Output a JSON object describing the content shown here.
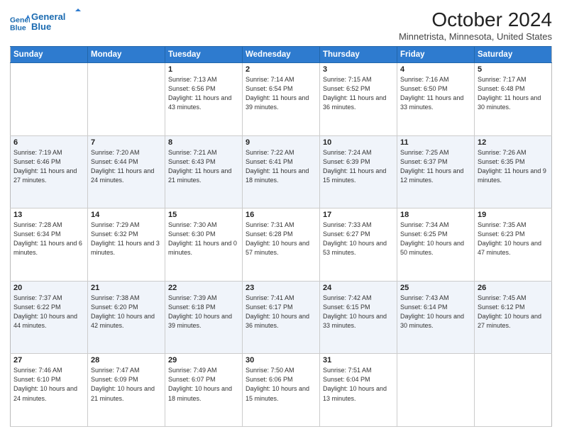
{
  "header": {
    "logo_line1": "General",
    "logo_line2": "Blue",
    "month_title": "October 2024",
    "location": "Minnetrista, Minnesota, United States"
  },
  "days_of_week": [
    "Sunday",
    "Monday",
    "Tuesday",
    "Wednesday",
    "Thursday",
    "Friday",
    "Saturday"
  ],
  "weeks": [
    [
      {
        "day": "",
        "sunrise": "",
        "sunset": "",
        "daylight": ""
      },
      {
        "day": "",
        "sunrise": "",
        "sunset": "",
        "daylight": ""
      },
      {
        "day": "1",
        "sunrise": "Sunrise: 7:13 AM",
        "sunset": "Sunset: 6:56 PM",
        "daylight": "Daylight: 11 hours and 43 minutes."
      },
      {
        "day": "2",
        "sunrise": "Sunrise: 7:14 AM",
        "sunset": "Sunset: 6:54 PM",
        "daylight": "Daylight: 11 hours and 39 minutes."
      },
      {
        "day": "3",
        "sunrise": "Sunrise: 7:15 AM",
        "sunset": "Sunset: 6:52 PM",
        "daylight": "Daylight: 11 hours and 36 minutes."
      },
      {
        "day": "4",
        "sunrise": "Sunrise: 7:16 AM",
        "sunset": "Sunset: 6:50 PM",
        "daylight": "Daylight: 11 hours and 33 minutes."
      },
      {
        "day": "5",
        "sunrise": "Sunrise: 7:17 AM",
        "sunset": "Sunset: 6:48 PM",
        "daylight": "Daylight: 11 hours and 30 minutes."
      }
    ],
    [
      {
        "day": "6",
        "sunrise": "Sunrise: 7:19 AM",
        "sunset": "Sunset: 6:46 PM",
        "daylight": "Daylight: 11 hours and 27 minutes."
      },
      {
        "day": "7",
        "sunrise": "Sunrise: 7:20 AM",
        "sunset": "Sunset: 6:44 PM",
        "daylight": "Daylight: 11 hours and 24 minutes."
      },
      {
        "day": "8",
        "sunrise": "Sunrise: 7:21 AM",
        "sunset": "Sunset: 6:43 PM",
        "daylight": "Daylight: 11 hours and 21 minutes."
      },
      {
        "day": "9",
        "sunrise": "Sunrise: 7:22 AM",
        "sunset": "Sunset: 6:41 PM",
        "daylight": "Daylight: 11 hours and 18 minutes."
      },
      {
        "day": "10",
        "sunrise": "Sunrise: 7:24 AM",
        "sunset": "Sunset: 6:39 PM",
        "daylight": "Daylight: 11 hours and 15 minutes."
      },
      {
        "day": "11",
        "sunrise": "Sunrise: 7:25 AM",
        "sunset": "Sunset: 6:37 PM",
        "daylight": "Daylight: 11 hours and 12 minutes."
      },
      {
        "day": "12",
        "sunrise": "Sunrise: 7:26 AM",
        "sunset": "Sunset: 6:35 PM",
        "daylight": "Daylight: 11 hours and 9 minutes."
      }
    ],
    [
      {
        "day": "13",
        "sunrise": "Sunrise: 7:28 AM",
        "sunset": "Sunset: 6:34 PM",
        "daylight": "Daylight: 11 hours and 6 minutes."
      },
      {
        "day": "14",
        "sunrise": "Sunrise: 7:29 AM",
        "sunset": "Sunset: 6:32 PM",
        "daylight": "Daylight: 11 hours and 3 minutes."
      },
      {
        "day": "15",
        "sunrise": "Sunrise: 7:30 AM",
        "sunset": "Sunset: 6:30 PM",
        "daylight": "Daylight: 11 hours and 0 minutes."
      },
      {
        "day": "16",
        "sunrise": "Sunrise: 7:31 AM",
        "sunset": "Sunset: 6:28 PM",
        "daylight": "Daylight: 10 hours and 57 minutes."
      },
      {
        "day": "17",
        "sunrise": "Sunrise: 7:33 AM",
        "sunset": "Sunset: 6:27 PM",
        "daylight": "Daylight: 10 hours and 53 minutes."
      },
      {
        "day": "18",
        "sunrise": "Sunrise: 7:34 AM",
        "sunset": "Sunset: 6:25 PM",
        "daylight": "Daylight: 10 hours and 50 minutes."
      },
      {
        "day": "19",
        "sunrise": "Sunrise: 7:35 AM",
        "sunset": "Sunset: 6:23 PM",
        "daylight": "Daylight: 10 hours and 47 minutes."
      }
    ],
    [
      {
        "day": "20",
        "sunrise": "Sunrise: 7:37 AM",
        "sunset": "Sunset: 6:22 PM",
        "daylight": "Daylight: 10 hours and 44 minutes."
      },
      {
        "day": "21",
        "sunrise": "Sunrise: 7:38 AM",
        "sunset": "Sunset: 6:20 PM",
        "daylight": "Daylight: 10 hours and 42 minutes."
      },
      {
        "day": "22",
        "sunrise": "Sunrise: 7:39 AM",
        "sunset": "Sunset: 6:18 PM",
        "daylight": "Daylight: 10 hours and 39 minutes."
      },
      {
        "day": "23",
        "sunrise": "Sunrise: 7:41 AM",
        "sunset": "Sunset: 6:17 PM",
        "daylight": "Daylight: 10 hours and 36 minutes."
      },
      {
        "day": "24",
        "sunrise": "Sunrise: 7:42 AM",
        "sunset": "Sunset: 6:15 PM",
        "daylight": "Daylight: 10 hours and 33 minutes."
      },
      {
        "day": "25",
        "sunrise": "Sunrise: 7:43 AM",
        "sunset": "Sunset: 6:14 PM",
        "daylight": "Daylight: 10 hours and 30 minutes."
      },
      {
        "day": "26",
        "sunrise": "Sunrise: 7:45 AM",
        "sunset": "Sunset: 6:12 PM",
        "daylight": "Daylight: 10 hours and 27 minutes."
      }
    ],
    [
      {
        "day": "27",
        "sunrise": "Sunrise: 7:46 AM",
        "sunset": "Sunset: 6:10 PM",
        "daylight": "Daylight: 10 hours and 24 minutes."
      },
      {
        "day": "28",
        "sunrise": "Sunrise: 7:47 AM",
        "sunset": "Sunset: 6:09 PM",
        "daylight": "Daylight: 10 hours and 21 minutes."
      },
      {
        "day": "29",
        "sunrise": "Sunrise: 7:49 AM",
        "sunset": "Sunset: 6:07 PM",
        "daylight": "Daylight: 10 hours and 18 minutes."
      },
      {
        "day": "30",
        "sunrise": "Sunrise: 7:50 AM",
        "sunset": "Sunset: 6:06 PM",
        "daylight": "Daylight: 10 hours and 15 minutes."
      },
      {
        "day": "31",
        "sunrise": "Sunrise: 7:51 AM",
        "sunset": "Sunset: 6:04 PM",
        "daylight": "Daylight: 10 hours and 13 minutes."
      },
      {
        "day": "",
        "sunrise": "",
        "sunset": "",
        "daylight": ""
      },
      {
        "day": "",
        "sunrise": "",
        "sunset": "",
        "daylight": ""
      }
    ]
  ]
}
